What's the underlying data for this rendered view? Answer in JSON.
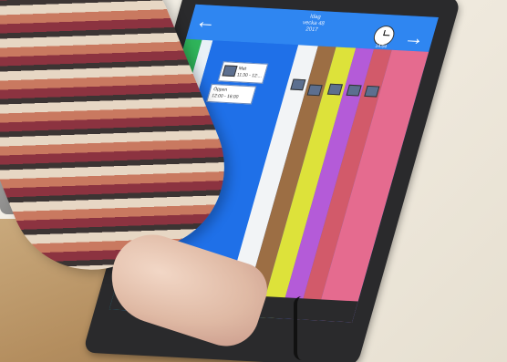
{
  "screen": {
    "title_line1": "Idag",
    "title_line2": "vecka 48",
    "title_line3": "2017",
    "clock_time": "14:04"
  },
  "cards": [
    {
      "title": "Mat",
      "time": "11:30 - 12:..."
    },
    {
      "title": "Öppen",
      "time": "12:00 - 16:00"
    }
  ],
  "colors": {
    "columns": [
      "#2fb45a",
      "#1f70e8",
      "#9c6e44",
      "#dde23a",
      "#b45bd8",
      "#d25a6a",
      "#e56b8f"
    ]
  }
}
